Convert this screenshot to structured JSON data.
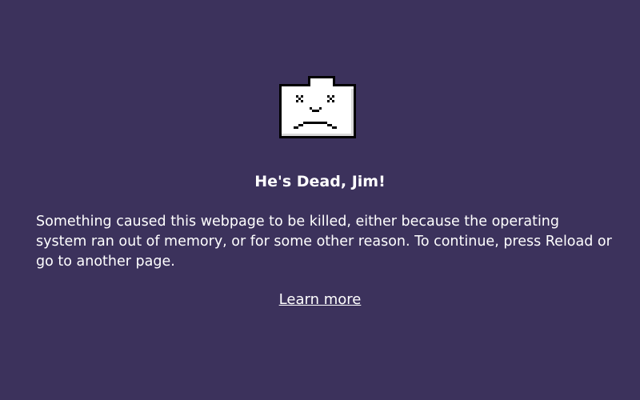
{
  "page": {
    "background_color": "#3c325c",
    "text_color": "#ffffff"
  },
  "icon": {
    "name": "sad-folder-icon"
  },
  "error": {
    "title": "He's Dead, Jim!",
    "message": "Something caused this webpage to be killed, either because the operating system ran out of memory, or for some other reason. To continue, press Reload or go to another page.",
    "learn_more_label": "Learn more"
  }
}
